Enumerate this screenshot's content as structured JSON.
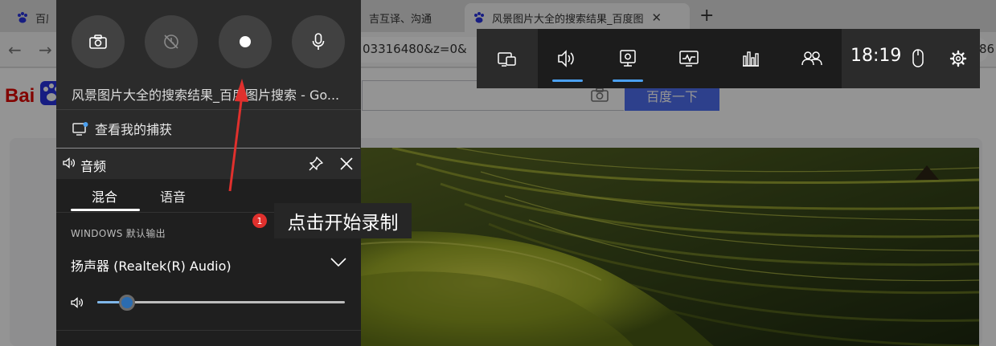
{
  "browser": {
    "tabs": [
      {
        "title": "百度"
      },
      {
        "title": "吉互译、沟通"
      },
      {
        "title": "风景图片大全的搜索结果_百度图"
      }
    ],
    "new_tab_label": "+",
    "url_fragment": "03316480&z=0&",
    "url_fragment_right": "86",
    "baidu_logo_text": "Bai",
    "search_button_label": "百度一下"
  },
  "capture_widget": {
    "buttons": [
      {
        "icon": "camera-icon"
      },
      {
        "icon": "record-last-icon"
      },
      {
        "icon": "record-icon"
      },
      {
        "icon": "microphone-icon"
      }
    ],
    "window_title": "风景图片大全的搜索结果_百度图片搜索 - Go...",
    "show_captures_label": "查看我的捕获"
  },
  "audio_widget": {
    "title": "音频",
    "tabs": [
      {
        "label": "混合",
        "selected": true
      },
      {
        "label": "语音",
        "selected": false
      }
    ],
    "output_section_label": "WINDOWS 默认输出",
    "device_name": "扬声器 (Realtek(R) Audio)",
    "volume_fraction": 0.12
  },
  "game_bar": {
    "widgets": [
      {
        "icon": "widget-menu-icon",
        "active": false
      },
      {
        "icon": "audio-icon",
        "active": true
      },
      {
        "icon": "capture-icon",
        "active": true
      },
      {
        "icon": "performance-icon",
        "active": false
      },
      {
        "icon": "resources-icon",
        "active": false
      },
      {
        "icon": "social-icon",
        "active": false
      }
    ],
    "clock": "18:19",
    "accent_color": "#4ba0f0"
  },
  "annotation": {
    "step_number": "1",
    "callout_text": "点击开始录制",
    "color": "#e0302d"
  }
}
